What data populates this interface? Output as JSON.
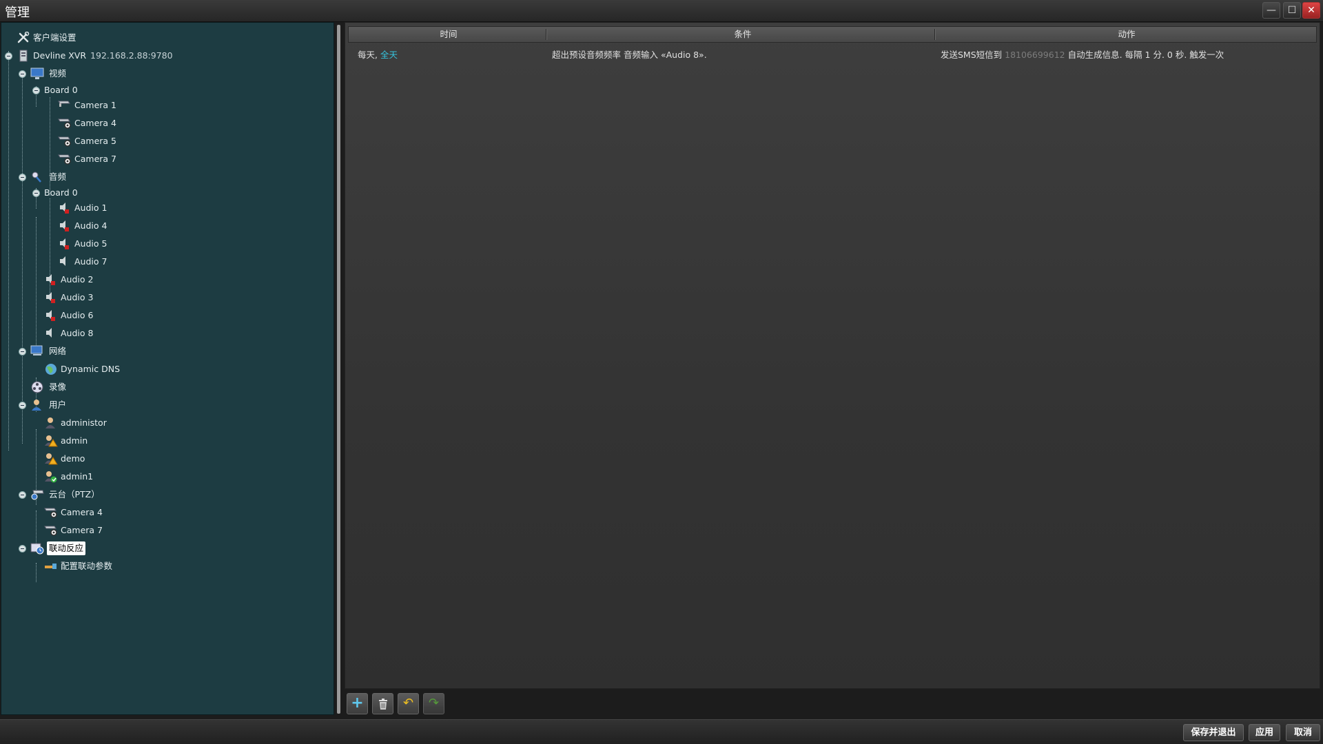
{
  "window": {
    "title": "管理"
  },
  "tree": {
    "client_settings": "客户端设置",
    "server_name": "Devline XVR",
    "server_ip": "192.168.2.88:9780",
    "video": "视频",
    "video_board": "Board 0",
    "cameras": [
      "Camera 1",
      "Camera 4",
      "Camera 5",
      "Camera 7"
    ],
    "audio": "音频",
    "audio_board": "Board 0",
    "board_audio": [
      "Audio 1",
      "Audio 4",
      "Audio 5",
      "Audio 7"
    ],
    "extra_audio": [
      "Audio 2",
      "Audio 3",
      "Audio 6",
      "Audio 8"
    ],
    "network": "网络",
    "dns": "Dynamic DNS",
    "recording": "录像",
    "users": "用户",
    "user_list": [
      "administor",
      "admin",
      "demo",
      "admin1"
    ],
    "ptz": "云台（PTZ）",
    "ptz_cameras": [
      "Camera 4",
      "Camera 7"
    ],
    "linkage": "联动反应",
    "linkage_config": "配置联动参数"
  },
  "table": {
    "headers": {
      "time": "时间",
      "condition": "条件",
      "action": "动作"
    },
    "rows": [
      {
        "time_prefix": "每天, ",
        "time_value": "全天",
        "condition": "超出预设音频频率 音频输入 «Audio 8».",
        "action_prefix": "发送SMS短信到 ",
        "action_phone": "18106699612",
        "action_suffix": " 自动生成信息. 每隔 1 分. 0 秒. 触发一次"
      }
    ]
  },
  "footer": {
    "save_exit": "保存并退出",
    "apply": "应用",
    "cancel": "取消"
  },
  "colors": {
    "accent": "#35c3dc",
    "tree_bg": "#1d3c42",
    "panel_bg": "#3a3a3a"
  },
  "icons": {
    "add": "plus-icon",
    "delete": "trash-icon",
    "undo": "undo-icon",
    "redo": "redo-icon",
    "camera": "camera-icon",
    "speaker": "speaker-icon",
    "user": "user-icon"
  }
}
